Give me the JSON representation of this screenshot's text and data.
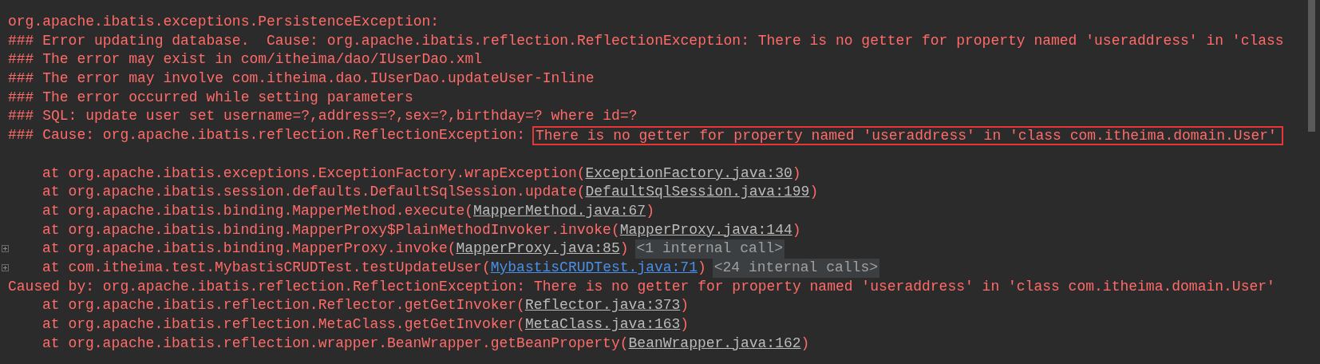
{
  "console": {
    "lines": [
      {
        "kind": "text",
        "text": "org.apache.ibatis.exceptions.PersistenceException:"
      },
      {
        "kind": "text",
        "text": "### Error updating database.  Cause: org.apache.ibatis.reflection.ReflectionException: There is no getter for property named 'useraddress' in 'class"
      },
      {
        "kind": "text",
        "text": "### The error may exist in com/itheima/dao/IUserDao.xml"
      },
      {
        "kind": "text",
        "text": "### The error may involve com.itheima.dao.IUserDao.updateUser-Inline"
      },
      {
        "kind": "text",
        "text": "### The error occurred while setting parameters"
      },
      {
        "kind": "text",
        "text": "### SQL: update user set username=?,address=?,sex=?,birthday=? where id=?"
      },
      {
        "kind": "highlight",
        "text": "### Cause: org.apache.ibatis.reflection.ReflectionException: ",
        "highlight": "There is no getter for property named 'useraddress' in 'class com.itheima.domain.User'",
        "highlighted": true
      },
      {
        "kind": "blank"
      },
      {
        "kind": "frame",
        "text": "at org.apache.ibatis.exceptions.ExceptionFactory.wrapException(",
        "link": "ExceptionFactory.java:30",
        "suffix": ")",
        "project": false,
        "expandable": false
      },
      {
        "kind": "frame",
        "text": "at org.apache.ibatis.session.defaults.DefaultSqlSession.update(",
        "link": "DefaultSqlSession.java:199",
        "suffix": ")",
        "project": false,
        "expandable": false
      },
      {
        "kind": "frame",
        "text": "at org.apache.ibatis.binding.MapperMethod.execute(",
        "link": "MapperMethod.java:67",
        "suffix": ")",
        "project": false,
        "expandable": false
      },
      {
        "kind": "frame",
        "text": "at org.apache.ibatis.binding.MapperProxy$PlainMethodInvoker.invoke(",
        "link": "MapperProxy.java:144",
        "suffix": ")",
        "project": false,
        "expandable": false
      },
      {
        "kind": "frame",
        "text": "at org.apache.ibatis.binding.MapperProxy.invoke(",
        "link": "MapperProxy.java:85",
        "suffix": ")",
        "project": false,
        "expandable": true,
        "badge": "<1 internal call>"
      },
      {
        "kind": "frame",
        "text": "at com.itheima.test.MybastisCRUDTest.testUpdateUser(",
        "link": "MybastisCRUDTest.java:71",
        "suffix": ")",
        "project": true,
        "expandable": true,
        "badge": "<24 internal calls>"
      },
      {
        "kind": "text",
        "text": "Caused by: org.apache.ibatis.reflection.ReflectionException: There is no getter for property named 'useraddress' in 'class com.itheima.domain.User'"
      },
      {
        "kind": "frame",
        "text": "at org.apache.ibatis.reflection.Reflector.getGetInvoker(",
        "link": "Reflector.java:373",
        "suffix": ")",
        "project": false,
        "expandable": false
      },
      {
        "kind": "frame",
        "text": "at org.apache.ibatis.reflection.MetaClass.getGetInvoker(",
        "link": "MetaClass.java:163",
        "suffix": ")",
        "project": false,
        "expandable": false
      },
      {
        "kind": "frame",
        "text": "at org.apache.ibatis.reflection.wrapper.BeanWrapper.getBeanProperty(",
        "link": "BeanWrapper.java:162",
        "suffix": ")",
        "project": false,
        "expandable": false
      }
    ]
  }
}
